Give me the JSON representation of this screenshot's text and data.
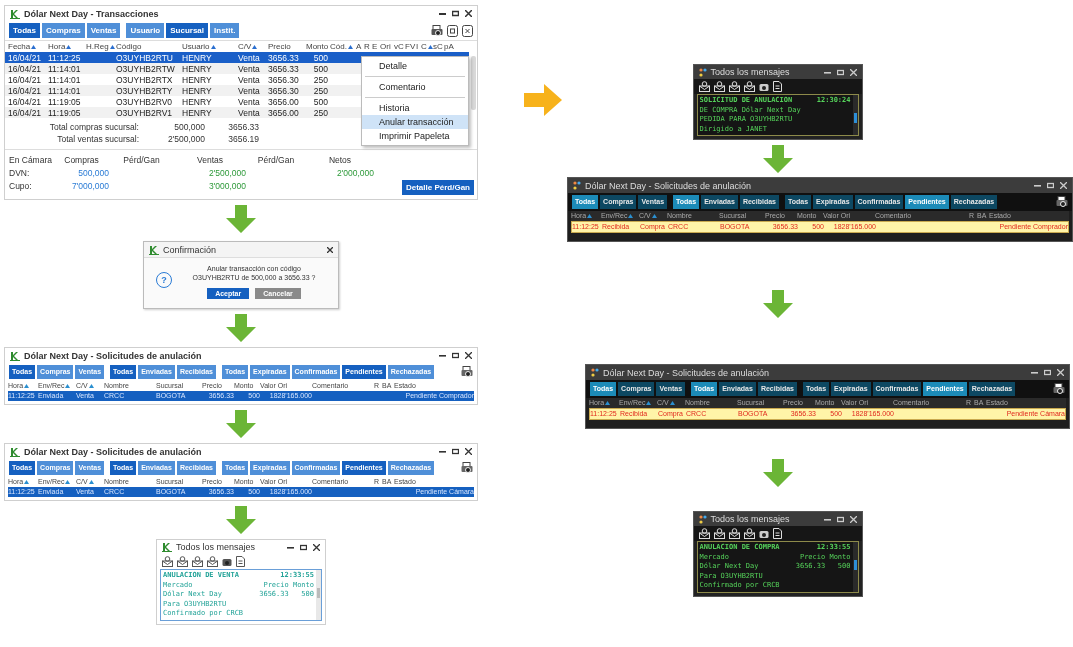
{
  "left_column": [
    {
      "kind": "transactions_window",
      "title": "Dólar Next Day - Transacciones",
      "tab_groups": [
        [
          {
            "label": "Todas",
            "selected": true
          },
          {
            "label": "Compras",
            "selected": false
          },
          {
            "label": "Ventas",
            "selected": false
          }
        ],
        [
          {
            "label": "Usuario",
            "selected": false
          },
          {
            "label": "Sucursal",
            "selected": true
          },
          {
            "label": "Instit.",
            "selected": false
          }
        ]
      ],
      "columns": [
        {
          "label": "Fecha",
          "sorted": true
        },
        {
          "label": "Hora",
          "sorted": true
        },
        {
          "label": "H.Reg",
          "sorted": true
        },
        {
          "label": "Código",
          "sorted": false
        },
        {
          "label": "Usuario",
          "sorted": true
        },
        {
          "label": "C/V",
          "sorted": true
        },
        {
          "label": "Precio",
          "sorted": false
        },
        {
          "label": "Monto",
          "sorted": false
        },
        {
          "label": "Cód.",
          "sorted": true
        },
        {
          "label": "A",
          "sorted": false
        },
        {
          "label": "R",
          "sorted": false
        },
        {
          "label": "E",
          "sorted": false
        },
        {
          "label": "Ori",
          "sorted": false
        },
        {
          "label": "vC",
          "sorted": false
        },
        {
          "label": "FV",
          "sorted": false
        },
        {
          "label": "I",
          "sorted": false
        },
        {
          "label": "C",
          "sorted": true
        },
        {
          "label": "sC",
          "sorted": false
        },
        {
          "label": "pA",
          "sorted": false
        }
      ],
      "rows": [
        {
          "fecha": "16/04/21",
          "hora": "11:12:25",
          "codigo": "O3UYHB2RTU",
          "usuario": "HENRY",
          "cv": "Venta",
          "precio": "3656.33",
          "monto": "500",
          "selected": true
        },
        {
          "fecha": "16/04/21",
          "hora": "11:14:01",
          "codigo": "O3UYHB2RTW",
          "usuario": "HENRY",
          "cv": "Venta",
          "precio": "3656.33",
          "monto": "500",
          "selected": false
        },
        {
          "fecha": "16/04/21",
          "hora": "11:14:01",
          "codigo": "O3UYHB2RTX",
          "usuario": "HENRY",
          "cv": "Venta",
          "precio": "3656.30",
          "monto": "250",
          "selected": false
        },
        {
          "fecha": "16/04/21",
          "hora": "11:14:01",
          "codigo": "O3UYHB2RTY",
          "usuario": "HENRY",
          "cv": "Venta",
          "precio": "3656.30",
          "monto": "250",
          "selected": false
        },
        {
          "fecha": "16/04/21",
          "hora": "11:19:05",
          "codigo": "O3UYHB2RV0",
          "usuario": "HENRY",
          "cv": "Venta",
          "precio": "3656.00",
          "monto": "500",
          "selected": false
        },
        {
          "fecha": "16/04/21",
          "hora": "11:19:05",
          "codigo": "O3UYHB2RV1",
          "usuario": "HENRY",
          "cv": "Venta",
          "precio": "3656.00",
          "monto": "250",
          "selected": false
        }
      ],
      "context_menu": [
        {
          "label": "Detalle",
          "selected": false,
          "divider_after": true
        },
        {
          "label": "Comentario",
          "selected": false,
          "divider_after": true
        },
        {
          "label": "Historia",
          "selected": false,
          "divider_after": false
        },
        {
          "label": "Anular transacción",
          "selected": true,
          "divider_after": false
        },
        {
          "label": "Imprimir Papeleta",
          "selected": false,
          "divider_after": false
        }
      ],
      "totals": [
        {
          "label": "Total compras sucursal:",
          "amount": "500,000",
          "price": "3656.33"
        },
        {
          "label": "Total ventas sucursal:",
          "amount": "2'500,000",
          "price": "3656.19"
        }
      ],
      "summary": {
        "columns": [
          "En Cámara",
          "Compras",
          "Pérd/Gan",
          "Ventas",
          "Pérd/Gan",
          "Netos"
        ],
        "rows": [
          {
            "label": "DVN:",
            "compras": "500,000",
            "ventas": "2'500,000",
            "netos": "2'000,000"
          },
          {
            "label": "Cupo:",
            "compras": "7'000,000",
            "ventas": "3'000,000"
          }
        ]
      },
      "button": "Detalle Pérd/Gan"
    },
    {
      "kind": "arrow"
    },
    {
      "kind": "confirm_dialog",
      "title": "Confirmación",
      "icon": "?",
      "message": [
        "Anular transacción con código",
        "O3UYHB2RTU de 500,000 a 3656.33 ?"
      ],
      "buttons": [
        {
          "label": "Aceptar",
          "primary": true
        },
        {
          "label": "Cancelar",
          "primary": false
        }
      ]
    },
    {
      "kind": "arrow"
    },
    {
      "kind": "requests_window",
      "dark": false,
      "title": "Dólar Next Day - Solicitudes de anulación",
      "tab_groups": [
        [
          {
            "label": "Todas",
            "selected": true
          },
          {
            "label": "Compras",
            "selected": false
          },
          {
            "label": "Ventas",
            "selected": false
          }
        ],
        [
          {
            "label": "Todas",
            "selected": true
          },
          {
            "label": "Enviadas",
            "selected": false
          },
          {
            "label": "Recibidas",
            "selected": false
          }
        ],
        [
          {
            "label": "Todas",
            "selected": false
          },
          {
            "label": "Expiradas",
            "selected": false
          },
          {
            "label": "Confirmadas",
            "selected": false
          },
          {
            "label": "Pendientes",
            "selected": true
          },
          {
            "label": "Rechazadas",
            "selected": false
          }
        ]
      ],
      "columns": [
        {
          "label": "Hora",
          "sorted": true
        },
        {
          "label": "Env/Rec",
          "sorted": true
        },
        {
          "label": "C/V",
          "sorted": true
        },
        {
          "label": "Nombre",
          "sorted": false
        },
        {
          "label": "Sucursal",
          "sorted": false
        },
        {
          "label": "Precio",
          "sorted": false
        },
        {
          "label": "Monto",
          "sorted": false
        },
        {
          "label": "Valor Ori",
          "sorted": false
        },
        {
          "label": "Comentario",
          "sorted": false
        },
        {
          "label": "R",
          "sorted": false
        },
        {
          "label": "BA",
          "sorted": false
        },
        {
          "label": "Estado",
          "sorted": false
        }
      ],
      "rows": [
        {
          "hora": "11:12:25",
          "envrec": "Enviada",
          "cv": "Venta",
          "nombre": "CRCC",
          "sucursal": "BOGOTA",
          "precio": "3656.33",
          "monto": "500",
          "valor": "1828'165.000",
          "estado": "Pendiente Comprador",
          "selected": true
        }
      ]
    },
    {
      "kind": "arrow"
    },
    {
      "kind": "requests_window",
      "dark": false,
      "title": "Dólar Next Day - Solicitudes de anulación",
      "tab_groups": [
        [
          {
            "label": "Todas",
            "selected": true
          },
          {
            "label": "Compras",
            "selected": false
          },
          {
            "label": "Ventas",
            "selected": false
          }
        ],
        [
          {
            "label": "Todas",
            "selected": true
          },
          {
            "label": "Enviadas",
            "selected": false
          },
          {
            "label": "Recibidas",
            "selected": false
          }
        ],
        [
          {
            "label": "Todas",
            "selected": false
          },
          {
            "label": "Expiradas",
            "selected": false
          },
          {
            "label": "Confirmadas",
            "selected": false
          },
          {
            "label": "Pendientes",
            "selected": true
          },
          {
            "label": "Rechazadas",
            "selected": false
          }
        ]
      ],
      "columns": [
        {
          "label": "Hora",
          "sorted": true
        },
        {
          "label": "Env/Rec",
          "sorted": true
        },
        {
          "label": "C/V",
          "sorted": true
        },
        {
          "label": "Nombre",
          "sorted": false
        },
        {
          "label": "Sucursal",
          "sorted": false
        },
        {
          "label": "Precio",
          "sorted": false
        },
        {
          "label": "Monto",
          "sorted": false
        },
        {
          "label": "Valor Ori",
          "sorted": false
        },
        {
          "label": "Comentario",
          "sorted": false
        },
        {
          "label": "R",
          "sorted": false
        },
        {
          "label": "BA",
          "sorted": false
        },
        {
          "label": "Estado",
          "sorted": false
        }
      ],
      "rows": [
        {
          "hora": "11:12:25",
          "envrec": "Enviada",
          "cv": "Venta",
          "nombre": "CRCC",
          "sucursal": "BOGOTA",
          "precio": "3656.33",
          "monto": "500",
          "valor": "1828'165.000",
          "estado": "Pendiente Cámara",
          "selected": true
        }
      ]
    },
    {
      "kind": "arrow"
    },
    {
      "kind": "messages_window",
      "dark": false,
      "title": "Todos los mensajes",
      "heading": {
        "text": "ANULACION DE VENTA",
        "time": "12:33:55"
      },
      "lines": [
        {
          "text": "Mercado",
          "right": "Precio Monto"
        },
        {
          "text": "Dólar Next Day",
          "right": "3656.33   500"
        },
        {
          "text": "Para O3UYHB2RTU"
        },
        {
          "text": "Confirmado por CRCB"
        }
      ]
    }
  ],
  "right_column": [
    {
      "kind": "messages_window",
      "dark": true,
      "title": "Todos los mensajes",
      "heading": {
        "text": "SOLICITUD DE ANULACION",
        "time": "12:30:24"
      },
      "lines": [
        {
          "text": "DE COMPRA Dólar Next Day"
        },
        {
          "text": "PEDIDA PARA O3UYHB2RTU"
        },
        {
          "text": "Dirigido a JANET"
        }
      ]
    },
    {
      "kind": "arrow"
    },
    {
      "kind": "requests_window",
      "dark": true,
      "title": "Dólar Next Day - Solicitudes de anulación",
      "tab_groups": [
        [
          {
            "label": "Todas",
            "selected": true
          },
          {
            "label": "Compras",
            "selected": false
          },
          {
            "label": "Ventas",
            "selected": false
          }
        ],
        [
          {
            "label": "Todas",
            "selected": true
          },
          {
            "label": "Enviadas",
            "selected": false
          },
          {
            "label": "Recibidas",
            "selected": false
          }
        ],
        [
          {
            "label": "Todas",
            "selected": false
          },
          {
            "label": "Expiradas",
            "selected": false
          },
          {
            "label": "Confirmadas",
            "selected": false
          },
          {
            "label": "Pendientes",
            "selected": true
          },
          {
            "label": "Rechazadas",
            "selected": false
          }
        ]
      ],
      "columns": [
        {
          "label": "Hora",
          "sorted": true
        },
        {
          "label": "Env/Rec",
          "sorted": true
        },
        {
          "label": "C/V",
          "sorted": true
        },
        {
          "label": "Nombre",
          "sorted": false
        },
        {
          "label": "Sucursal",
          "sorted": false
        },
        {
          "label": "Precio",
          "sorted": false
        },
        {
          "label": "Monto",
          "sorted": false
        },
        {
          "label": "Valor Ori",
          "sorted": false
        },
        {
          "label": "Comentario",
          "sorted": false
        },
        {
          "label": "R",
          "sorted": false
        },
        {
          "label": "BA",
          "sorted": false
        },
        {
          "label": "Estado",
          "sorted": false
        }
      ],
      "rows": [
        {
          "hora": "11:12:25",
          "envrec": "Recibida",
          "cv": "Compra",
          "nombre": "CRCC",
          "sucursal": "BOGOTA",
          "precio": "3656.33",
          "monto": "500",
          "valor": "1828'165.000",
          "estado": "Pendiente Comprador",
          "selected": true
        }
      ]
    },
    {
      "kind": "arrow"
    },
    {
      "kind": "requests_window",
      "dark": true,
      "title": "Dólar Next Day - Solicitudes de anulación",
      "tab_groups": [
        [
          {
            "label": "Todas",
            "selected": true
          },
          {
            "label": "Compras",
            "selected": false
          },
          {
            "label": "Ventas",
            "selected": false
          }
        ],
        [
          {
            "label": "Todas",
            "selected": true
          },
          {
            "label": "Enviadas",
            "selected": false
          },
          {
            "label": "Recibidas",
            "selected": false
          }
        ],
        [
          {
            "label": "Todas",
            "selected": false
          },
          {
            "label": "Expiradas",
            "selected": false
          },
          {
            "label": "Confirmadas",
            "selected": false
          },
          {
            "label": "Pendientes",
            "selected": true
          },
          {
            "label": "Rechazadas",
            "selected": false
          }
        ]
      ],
      "columns": [
        {
          "label": "Hora",
          "sorted": true
        },
        {
          "label": "Env/Rec",
          "sorted": true
        },
        {
          "label": "C/V",
          "sorted": true
        },
        {
          "label": "Nombre",
          "sorted": false
        },
        {
          "label": "Sucursal",
          "sorted": false
        },
        {
          "label": "Precio",
          "sorted": false
        },
        {
          "label": "Monto",
          "sorted": false
        },
        {
          "label": "Valor Ori",
          "sorted": false
        },
        {
          "label": "Comentario",
          "sorted": false
        },
        {
          "label": "R",
          "sorted": false
        },
        {
          "label": "BA",
          "sorted": false
        },
        {
          "label": "Estado",
          "sorted": false
        }
      ],
      "rows": [
        {
          "hora": "11:12:25",
          "envrec": "Recibida",
          "cv": "Compra",
          "nombre": "CRCC",
          "sucursal": "BOGOTA",
          "precio": "3656.33",
          "monto": "500",
          "valor": "1828'165.000",
          "estado": "Pendiente Cámara",
          "selected": true
        }
      ]
    },
    {
      "kind": "arrow"
    },
    {
      "kind": "messages_window",
      "dark": true,
      "title": "Todos los mensajes",
      "heading": {
        "text": "ANULACION DE COMPRA",
        "time": "12:33:55"
      },
      "lines": [
        {
          "text": "Mercado",
          "right": "Precio Monto"
        },
        {
          "text": "Dólar Next Day",
          "right": "3656.33   500"
        },
        {
          "text": "Para O3UYHB2RTU"
        },
        {
          "text": "Confirmado por CRCB"
        }
      ]
    }
  ]
}
